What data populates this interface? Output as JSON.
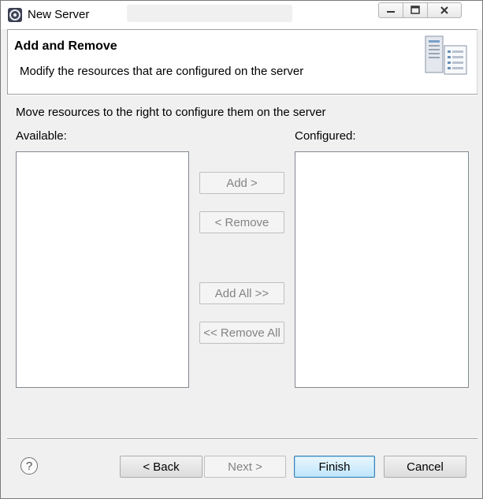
{
  "window": {
    "title": "New Server",
    "title_icon": "eclipse-server-icon",
    "controls": {
      "minimize_icon": "minimize-icon",
      "maximize_icon": "maximize-icon",
      "close_icon": "close-icon"
    }
  },
  "header": {
    "title": "Add and Remove",
    "description": "Modify the resources that are configured on the server",
    "image_icon": "server-resources-icon"
  },
  "body": {
    "message": "Move resources to the right to configure them on the server",
    "available_label": "Available:",
    "configured_label": "Configured:",
    "available_items": [],
    "configured_items": [],
    "buttons": {
      "add": "Add >",
      "remove": "< Remove",
      "add_all": "Add All >>",
      "remove_all": "<< Remove All"
    }
  },
  "footer": {
    "help_icon": "help-icon",
    "help_glyph": "?",
    "back": "< Back",
    "next": "Next >",
    "finish": "Finish",
    "cancel": "Cancel"
  },
  "colors": {
    "dialog_bg": "#f0f0f0",
    "header_bg": "#ffffff",
    "disabled_text": "#838383",
    "default_button_border": "#3c7fb1"
  }
}
